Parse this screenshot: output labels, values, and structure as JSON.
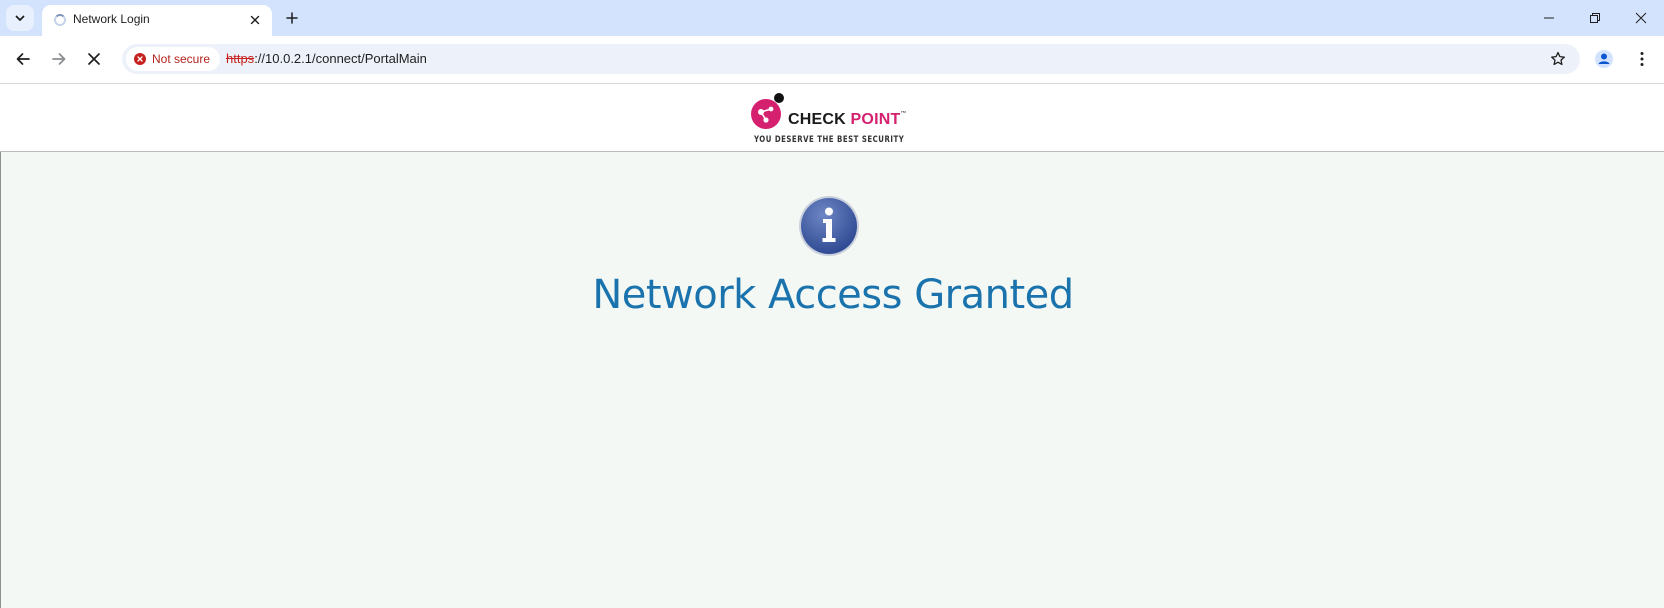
{
  "browser": {
    "tab": {
      "title": "Network Login"
    },
    "address_bar": {
      "security_label": "Not secure",
      "url_scheme": "https",
      "url_rest": "://10.0.2.1/connect/PortalMain"
    }
  },
  "header": {
    "logo": {
      "brand_first": "CHECK ",
      "brand_second": "POINT",
      "trademark": "™",
      "tagline": "YOU DESERVE THE BEST SECURITY"
    }
  },
  "main": {
    "status_title": "Network Access Granted"
  },
  "icons": {
    "tab_search": "chevron-down-icon",
    "tab_loading": "spinner-icon",
    "tab_close": "close-icon",
    "new_tab": "plus-icon",
    "back": "back-arrow-icon",
    "forward": "forward-arrow-icon",
    "stop": "stop-icon",
    "security": "error-circle-icon",
    "bookmark": "star-icon",
    "profile": "person-icon",
    "menu": "vertical-dots-icon",
    "status": "info-icon"
  },
  "colors": {
    "tabstrip": "#d3e3fd",
    "omnibox": "#edf2fa",
    "not_secure": "#c5221f",
    "brand_accent": "#d51f6f",
    "status_title": "#1a73ad",
    "page_background": "#f4f8f5"
  }
}
